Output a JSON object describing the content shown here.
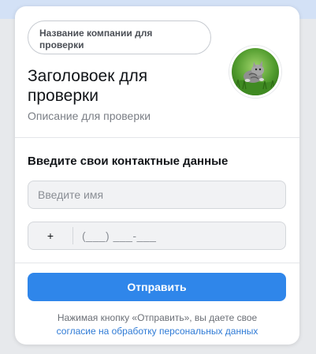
{
  "header": {
    "company_name": "Название компании для проверки",
    "headline": "Заголовоек для проверки",
    "description": "Описание для проверки",
    "avatar_icon": "kitten-on-grass-photo"
  },
  "form": {
    "title": "Введите свои контактные данные",
    "name_placeholder": "Введите имя",
    "phone_prefix": "+",
    "phone_mask": "(___) ___-___",
    "submit_label": "Отправить"
  },
  "consent": {
    "text": "Нажимая кнопку «Отправить», вы даете свое",
    "link_text": "согласие на обработку персональных данных"
  },
  "colors": {
    "accent": "#2f86ea",
    "link": "#2f7bd6",
    "background_strip": "#d3e1f6"
  }
}
